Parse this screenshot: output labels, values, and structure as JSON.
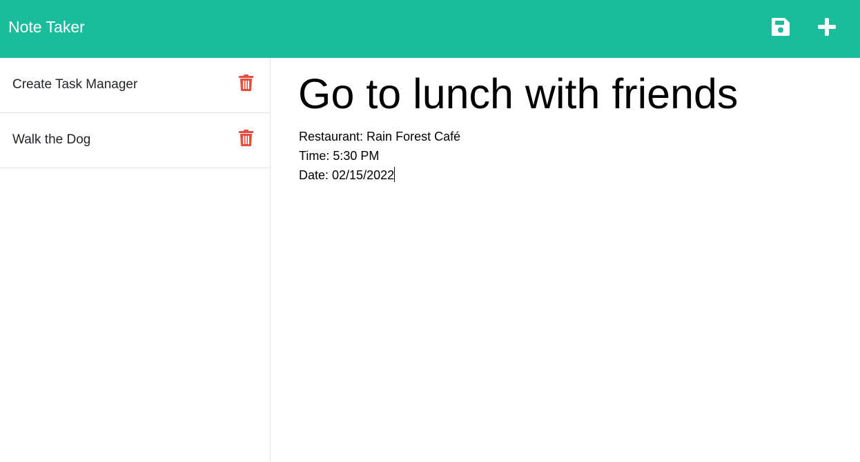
{
  "header": {
    "brand": "Note Taker",
    "background_color": "#1abc9c",
    "icons": [
      "save-icon",
      "plus-icon"
    ]
  },
  "sidebar": {
    "items": [
      {
        "title": "Create Task Manager",
        "icon": "trash-icon"
      },
      {
        "title": "Walk the Dog",
        "icon": "trash-icon"
      }
    ],
    "delete_color": "#e74c3c"
  },
  "editor": {
    "title": "Go to lunch with friends",
    "body_lines": [
      "Restaurant: Rain Forest Café",
      "Time: 5:30 PM",
      "Date: 02/15/2022"
    ]
  }
}
